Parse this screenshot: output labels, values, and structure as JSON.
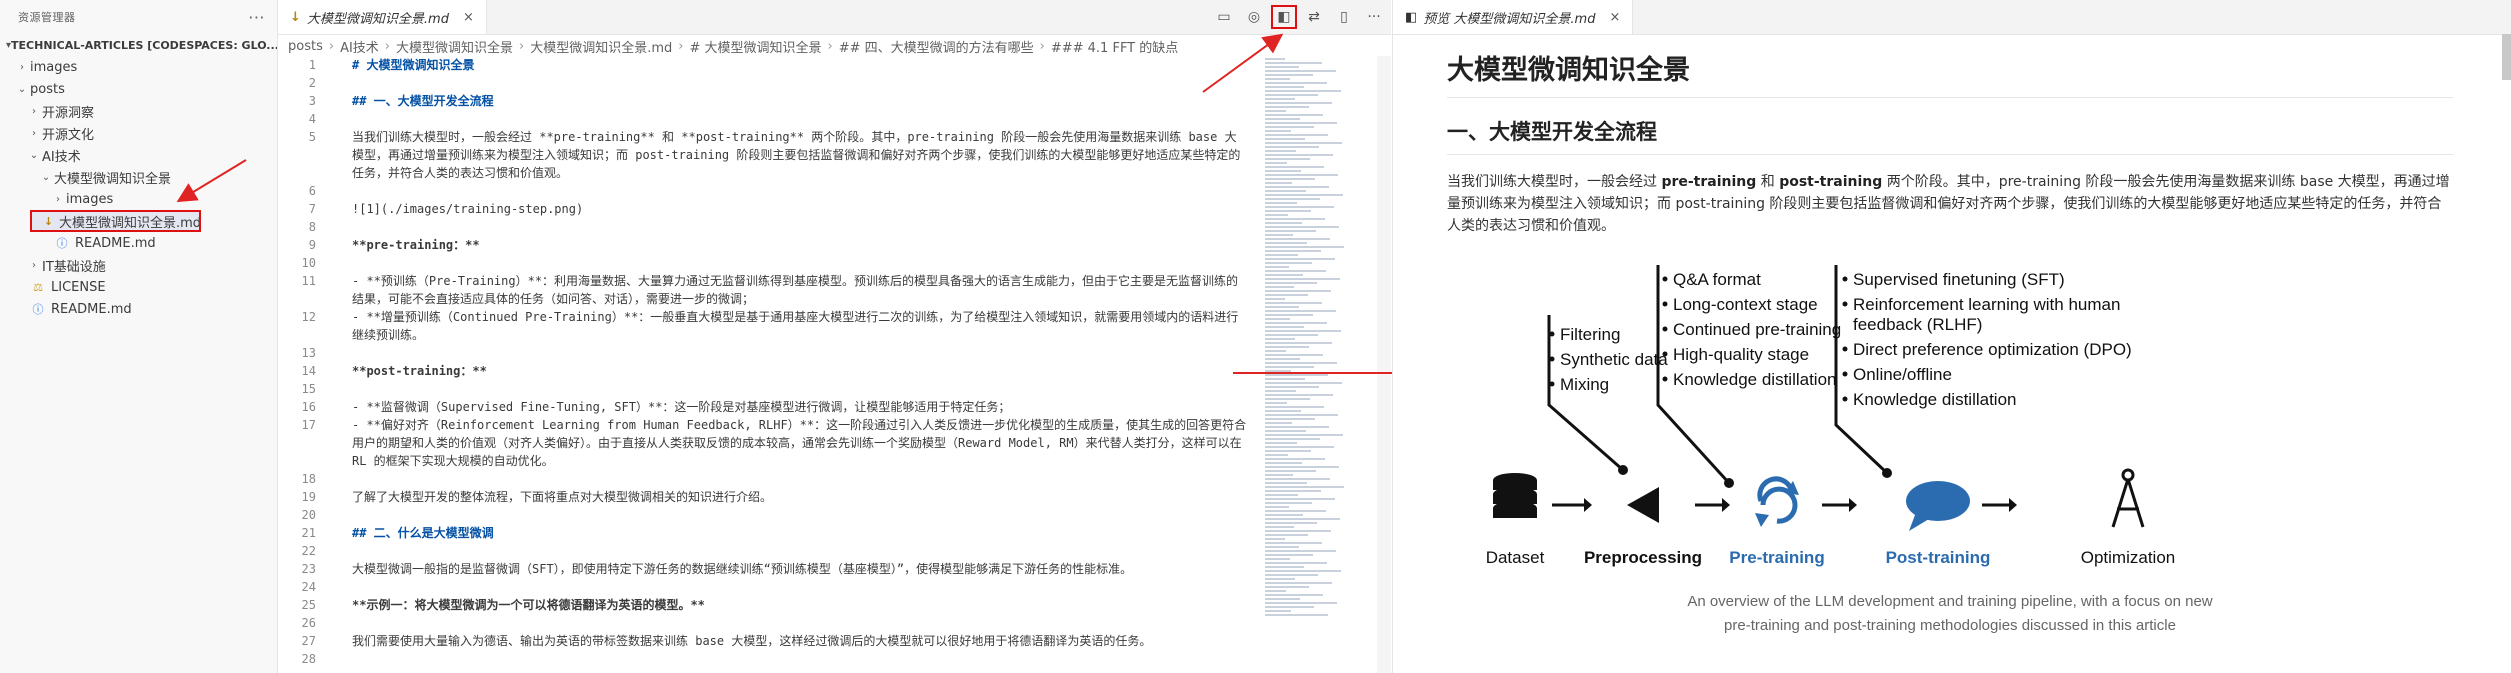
{
  "explorer": {
    "title": "资源管理器",
    "project": "TECHNICAL-ARTICLES [CODESPACES: GLO...",
    "items": [
      {
        "label": "images",
        "depth": 0,
        "type": "folder",
        "open": false
      },
      {
        "label": "posts",
        "depth": 0,
        "type": "folder",
        "open": true
      },
      {
        "label": "开源洞察",
        "depth": 1,
        "type": "folder",
        "open": false
      },
      {
        "label": "开源文化",
        "depth": 1,
        "type": "folder",
        "open": false
      },
      {
        "label": "AI技术",
        "depth": 1,
        "type": "folder",
        "open": true
      },
      {
        "label": "大模型微调知识全景",
        "depth": 2,
        "type": "folder",
        "open": true
      },
      {
        "label": "images",
        "depth": 3,
        "type": "folder",
        "open": false
      },
      {
        "label": "大模型微调知识全景.md",
        "depth": 3,
        "type": "md",
        "selected": true
      },
      {
        "label": "README.md",
        "depth": 2,
        "type": "info"
      },
      {
        "label": "IT基础设施",
        "depth": 1,
        "type": "folder",
        "open": false
      },
      {
        "label": "LICENSE",
        "depth": 0,
        "type": "license"
      },
      {
        "label": "README.md",
        "depth": 0,
        "type": "info"
      }
    ]
  },
  "editor": {
    "tab_label": "大模型微调知识全景.md",
    "breadcrumb": [
      "posts",
      "AI技术",
      "大模型微调知识全景",
      "大模型微调知识全景.md",
      "# 大模型微调知识全景",
      "## 四、大模型微调的方法有哪些",
      "### 4.1 FFT 的缺点"
    ],
    "lines": [
      {
        "n": "1",
        "t": "# 大模型微调知识全景",
        "style": "h1"
      },
      {
        "n": "2",
        "t": "",
        "style": ""
      },
      {
        "n": "3",
        "t": "## 一、大模型开发全流程",
        "style": "h2"
      },
      {
        "n": "4",
        "t": "",
        "style": ""
      },
      {
        "n": "5",
        "t": "当我们训练大模型时，一般会经过 **pre-training** 和 **post-training** 两个阶段。其中，pre-training 阶段一般会先使用海量数据来训练 base 大模型，再通过增量预训练来为模型注入领域知识；而 post-training 阶段则主要包括监督微调和偏好对齐两个步骤，使我们训练的大模型能够更好地适应某些特定的任务，并符合人类的表达习惯和价值观。",
        "style": ""
      },
      {
        "n": "6",
        "t": "",
        "style": ""
      },
      {
        "n": "7",
        "t": "![1](./images/training-step.png)",
        "style": ""
      },
      {
        "n": "8",
        "t": "",
        "style": ""
      },
      {
        "n": "9",
        "t": "**pre-training：**",
        "style": "bold"
      },
      {
        "n": "10",
        "t": "",
        "style": ""
      },
      {
        "n": "11",
        "t": "- **预训练（Pre-Training）**：利用海量数据、大量算力通过无监督训练得到基座模型。预训练后的模型具备强大的语言生成能力，但由于它主要是无监督训练的结果，可能不会直接适应具体的任务（如问答、对话），需要进一步的微调；",
        "style": ""
      },
      {
        "n": "12",
        "t": "- **增量预训练（Continued Pre-Training）**：一般垂直大模型是基于通用基座大模型进行二次的训练，为了给模型注入领域知识，就需要用领域内的语料进行继续预训练。",
        "style": ""
      },
      {
        "n": "13",
        "t": "",
        "style": ""
      },
      {
        "n": "14",
        "t": "**post-training：**",
        "style": "bold"
      },
      {
        "n": "15",
        "t": "",
        "style": ""
      },
      {
        "n": "16",
        "t": "- **监督微调（Supervised Fine-Tuning, SFT）**：这一阶段是对基座模型进行微调，让模型能够适用于特定任务；",
        "style": ""
      },
      {
        "n": "17",
        "t": "- **偏好对齐（Reinforcement Learning from Human Feedback, RLHF）**：这一阶段通过引入人类反馈进一步优化模型的生成质量，使其生成的回答更符合用户的期望和人类的价值观（对齐人类偏好）。由于直接从人类获取反馈的成本较高，通常会先训练一个奖励模型（Reward Model, RM）来代替人类打分，这样可以在 RL 的框架下实现大规模的自动优化。",
        "style": ""
      },
      {
        "n": "18",
        "t": "",
        "style": ""
      },
      {
        "n": "19",
        "t": "了解了大模型开发的整体流程，下面将重点对大模型微调相关的知识进行介绍。",
        "style": ""
      },
      {
        "n": "20",
        "t": "",
        "style": ""
      },
      {
        "n": "21",
        "t": "## 二、什么是大模型微调",
        "style": "h2"
      },
      {
        "n": "22",
        "t": "",
        "style": ""
      },
      {
        "n": "23",
        "t": "大模型微调一般指的是监督微调（SFT），即使用特定下游任务的数据继续训练“预训练模型（基座模型）”，使得模型能够满足下游任务的性能标准。",
        "style": ""
      },
      {
        "n": "24",
        "t": "",
        "style": ""
      },
      {
        "n": "25",
        "t": "**示例一：将大模型微调为一个可以将德语翻译为英语的模型。**",
        "style": "bold"
      },
      {
        "n": "26",
        "t": "",
        "style": ""
      },
      {
        "n": "27",
        "t": "我们需要使用大量输入为德语、输出为英语的带标签数据来训练 base 大模型，这样经过微调后的大模型就可以很好地用于将德语翻译为英语的任务。",
        "style": ""
      },
      {
        "n": "28",
        "t": "",
        "style": ""
      }
    ]
  },
  "preview": {
    "tab_label": "预览 大模型微调知识全景.md",
    "h1": "大模型微调知识全景",
    "h2": "一、大模型开发全流程",
    "para_parts": [
      "当我们训练大模型时，一般会经过 ",
      "pre-training",
      " 和 ",
      "post-training",
      " 两个阶段。其中，pre-training 阶段一般会先使用海量数据来训练 base 大模型，再通过增量预训练来为模型注入领域知识；而 post-training 阶段则主要包括监督微调和偏好对齐两个步骤，使我们训练的大模型能够更好地适应某些特定的任务，并符合人类的表达习惯和价值观。"
    ],
    "diagram": {
      "groups": [
        {
          "items": [
            "Filtering",
            "Synthetic data",
            "Mixing"
          ]
        },
        {
          "items": [
            "Q&A format",
            "Long-context stage",
            "Continued pre-training",
            "High-quality stage",
            "Knowledge distillation"
          ]
        },
        {
          "items": [
            "Supervised finetuning (SFT)",
            "Reinforcement learning with human feedback (RLHF)",
            "Direct preference optimization (DPO)",
            "Online/offline",
            "Knowledge distillation"
          ]
        }
      ],
      "stages": [
        "Dataset",
        "Preprocessing",
        "Pre-training",
        "Post-training",
        "Optimization"
      ],
      "caption_lines": [
        "An overview of the LLM development and training pipeline, with a focus on new",
        "pre-training and post-training methodologies discussed in this article"
      ],
      "colors": {
        "accent_blue": "#2b6cb0",
        "dark": "#111111"
      }
    }
  }
}
